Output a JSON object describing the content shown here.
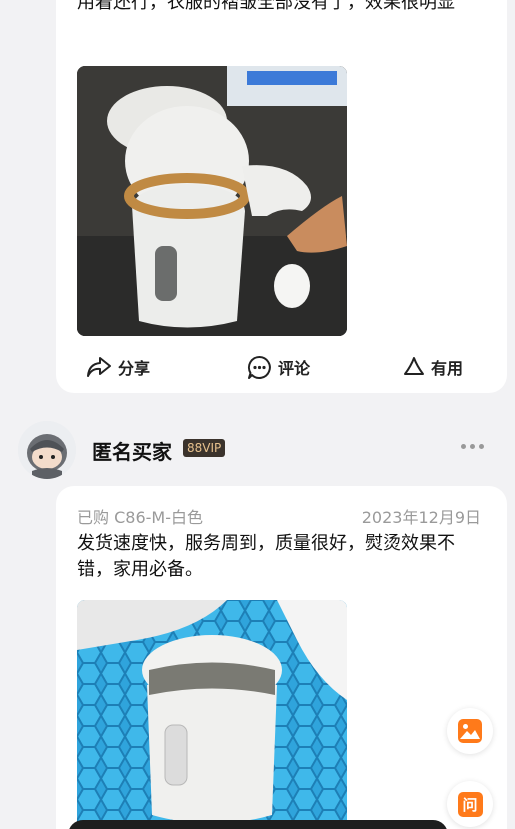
{
  "review1": {
    "text": "用着还行，衣服的褶皱全部没有了，效果很明显"
  },
  "actions": {
    "share": "分享",
    "comment": "评论",
    "useful": "有用"
  },
  "review2": {
    "user": "匿名买家",
    "badge": "88VIP",
    "spec": "已购 C86-M-白色",
    "date": "2023年12月9日",
    "text": "发货速度快，服务周到，质量很好，熨烫效果不错，家用必备。"
  },
  "floating": {
    "ask_label": "问"
  },
  "colors": {
    "accent": "#ff7a1a",
    "vip_bg": "#3b332c",
    "vip_text": "#e7c18d"
  }
}
